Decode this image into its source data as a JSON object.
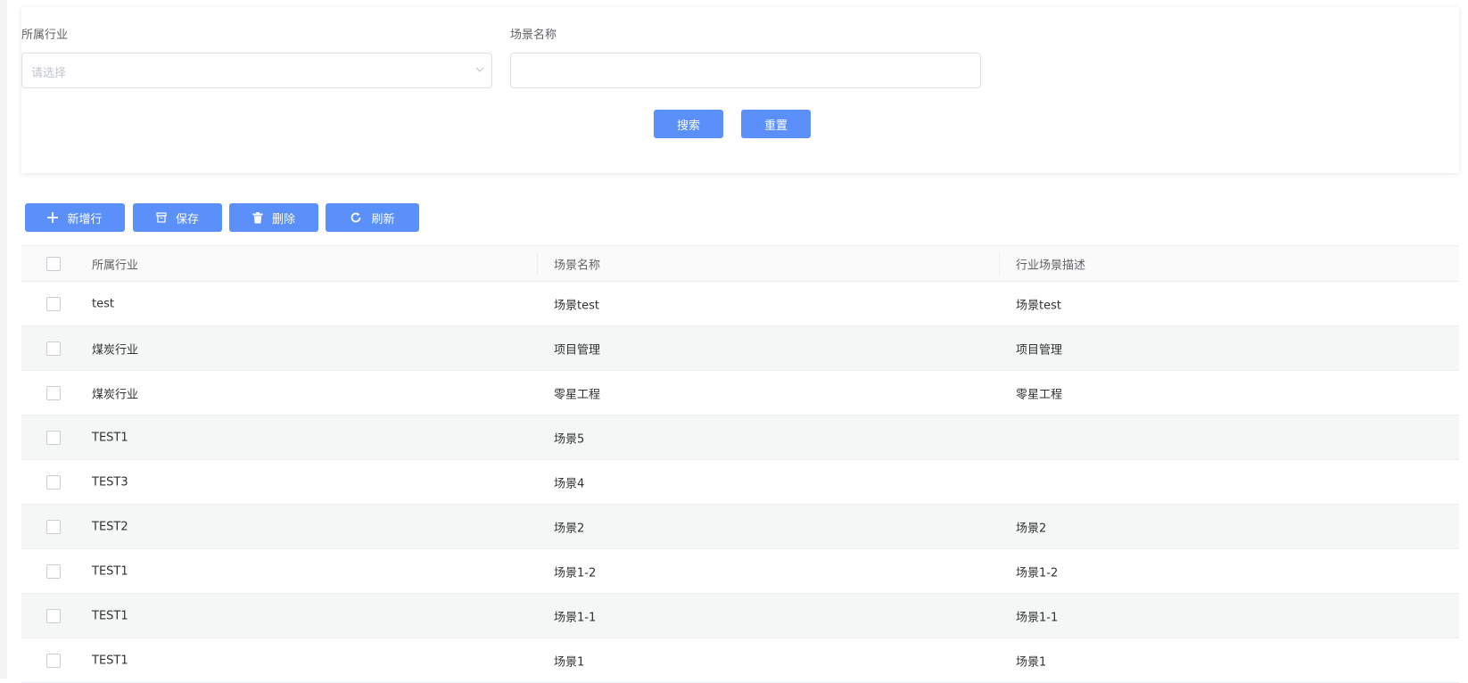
{
  "search": {
    "industry_label": "所属行业",
    "industry_placeholder": "请选择",
    "scene_label": "场景名称",
    "scene_value": "",
    "search_button": "搜索",
    "reset_button": "重置"
  },
  "toolbar": {
    "add_row": "新增行",
    "save": "保存",
    "delete": "删除",
    "refresh": "刷新"
  },
  "table": {
    "columns": [
      "所属行业",
      "场景名称",
      "行业场景描述"
    ],
    "rows": [
      {
        "industry": "test",
        "scene": "场景test",
        "desc": "场景test"
      },
      {
        "industry": "煤炭行业",
        "scene": "项目管理",
        "desc": "项目管理"
      },
      {
        "industry": "煤炭行业",
        "scene": "零星工程",
        "desc": "零星工程"
      },
      {
        "industry": "TEST1",
        "scene": "场景5",
        "desc": ""
      },
      {
        "industry": "TEST3",
        "scene": "场景4",
        "desc": ""
      },
      {
        "industry": "TEST2",
        "scene": "场景2",
        "desc": "场景2"
      },
      {
        "industry": "TEST1",
        "scene": "场景1-2",
        "desc": "场景1-2"
      },
      {
        "industry": "TEST1",
        "scene": "场景1-1",
        "desc": "场景1-1"
      },
      {
        "industry": "TEST1",
        "scene": "场景1",
        "desc": "场景1"
      }
    ]
  },
  "colors": {
    "primary": "#5b8ff9",
    "stripe": "#f5f7f7",
    "border": "#ebeef5"
  },
  "icons": {
    "add": "plus-icon",
    "save": "archive-icon",
    "delete": "trash-icon",
    "refresh": "refresh-icon",
    "select": "chevron-down-icon"
  }
}
